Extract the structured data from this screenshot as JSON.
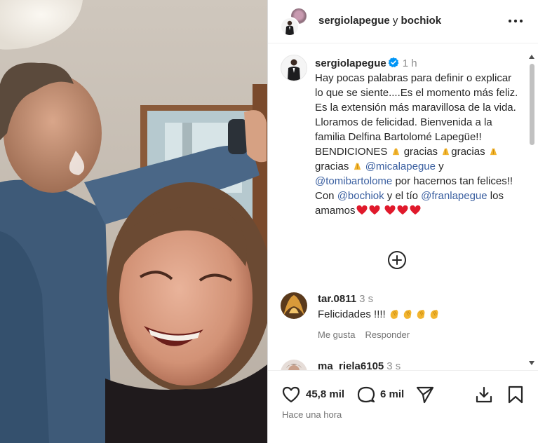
{
  "post": {
    "image_alt": "",
    "header": {
      "user1": "sergiolapegue",
      "conjunction": "y",
      "user2": "bochiok",
      "more_icon": "more-horizontal-icon"
    },
    "caption": {
      "username": "sergiolapegue",
      "verified": true,
      "time": "1 h",
      "line1": "Hay pocas palabras para definir o explicar lo que se siente....Es el momento más feliz. Es la extensión más maravillosa de la vida. Lloramos de felicidad. Bienvenida a la familia Delfina Bartolomé Lapegüe!! BENDICIONES ",
      "gracias1": " gracias ",
      "gracias2": "gracias ",
      "gracias3": "gracias ",
      "mention1": "@micalapegue",
      "y": " y ",
      "mention2": "@tomibartolome",
      "por": " por hacernos tan felices!! Con ",
      "mention3": "@bochiok",
      "y_el_tio": " y el tío ",
      "mention4": "@franlapegue",
      "los_amamos": " los amamos"
    },
    "load_more_icon": "plus-circle-icon",
    "comments": [
      {
        "username": "tar.0811",
        "time": "3 s",
        "text": "Felicidades !!!! ",
        "like_label": "Me gusta",
        "reply_label": "Responder"
      },
      {
        "username": "ma_riela6105",
        "time": "3 s"
      }
    ],
    "actions": {
      "likes": "45,8 mil",
      "comments": "6 mil",
      "posted": "Hace una hora"
    },
    "colors": {
      "link": "#3a5fa0",
      "verified": "#0095f6",
      "heart_emoji": "#e0192b",
      "pray_emoji": "#f2b530",
      "muted": "#737373"
    }
  }
}
